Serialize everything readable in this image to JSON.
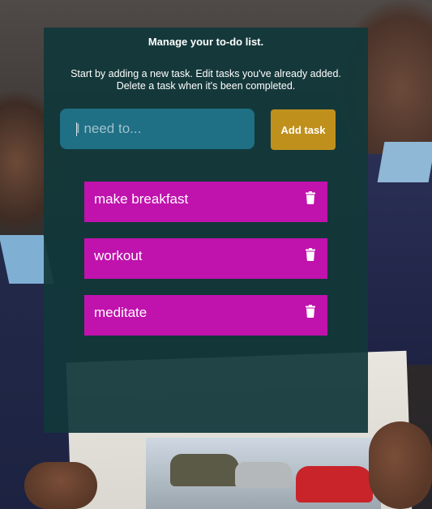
{
  "header": {
    "title": "Manage your to-do list.",
    "instructions_line1": "Start by adding a new task. Edit tasks you've already added.",
    "instructions_line2": "Delete a task when it's been completed."
  },
  "new_task": {
    "placeholder": "I need to...",
    "value": ""
  },
  "add_button": {
    "label": "Add task"
  },
  "tasks": [
    {
      "label": "make breakfast",
      "action_icon": "trash-icon"
    },
    {
      "label": "workout",
      "action_icon": "trash-icon"
    },
    {
      "label": "meditate",
      "action_icon": "trash-icon"
    }
  ],
  "colors": {
    "panel": "#11383a",
    "input": "#1f6f85",
    "add_button": "#c0901c",
    "task": "#c012ad",
    "text": "#ffffff"
  }
}
